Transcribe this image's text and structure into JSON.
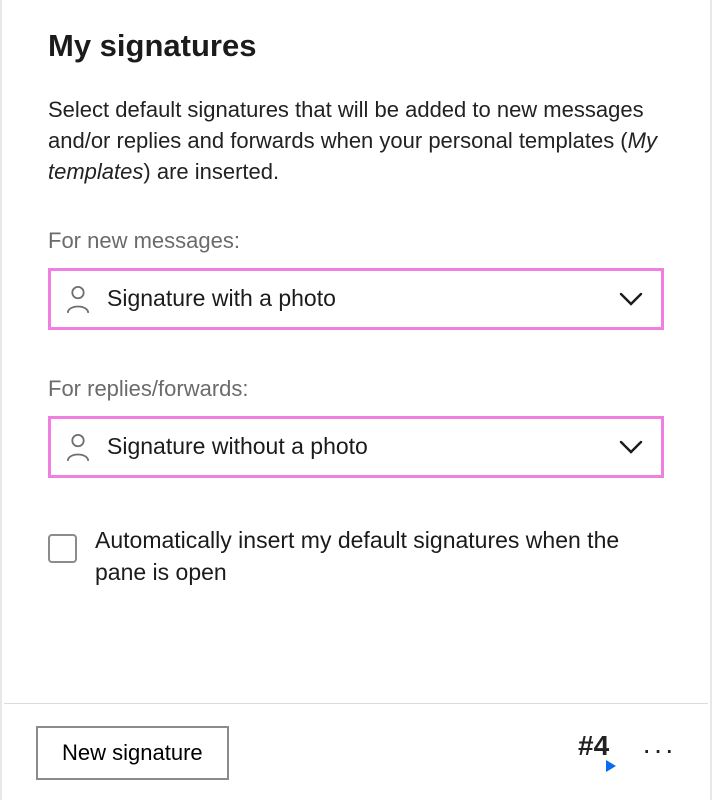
{
  "title": "My signatures",
  "help_text_prefix": "Select default signatures that will be added to new messages and/or replies and forwards when your personal templates (",
  "help_text_italic": "My templates",
  "help_text_suffix": ") are inserted.",
  "new_messages": {
    "label": "For new messages:",
    "value": "Signature with a photo"
  },
  "replies_forwards": {
    "label": "For replies/forwards:",
    "value": "Signature without a photo"
  },
  "auto_insert_label": "Automatically insert my default signatures when the pane is open",
  "auto_insert_checked": false,
  "new_signature_button": "New signature",
  "hash_symbol": "#4",
  "more_symbol": "···",
  "colors": {
    "dropdown_border": "#ef7fe0",
    "accent_blue": "#0a6af0"
  }
}
